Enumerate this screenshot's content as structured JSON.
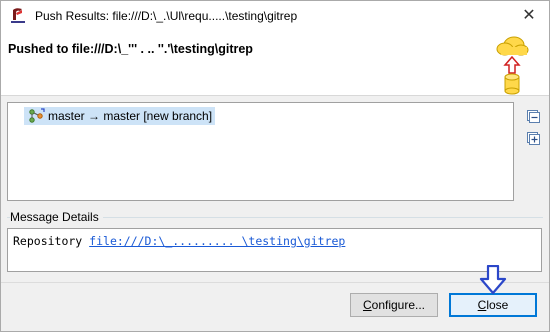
{
  "window": {
    "title": "Push Results: file:///D:\\_.\\Ul\\requ.....\\testing\\gitrep",
    "close_glyph": "✕"
  },
  "header": {
    "title": "Pushed to file:///D:\\_'''  .    ..  ''.'\\testing\\gitrep",
    "image_icon": "cloud-push-database-icon"
  },
  "results": {
    "rows": [
      {
        "icon": "branch-push-icon",
        "label": "master → master [new branch]"
      }
    ],
    "collapse_icon": "collapse-all-icon",
    "expand_icon": "expand-all-icon"
  },
  "message_details": {
    "label": "Message Details",
    "prefix": "Repository ",
    "link": "file:///D:\\_.........  \\testing\\gitrep"
  },
  "buttons": {
    "configure": {
      "label": "Configure...",
      "mnemonic": "C",
      "rest": "onfigure..."
    },
    "close": {
      "label": "Close",
      "mnemonic": "C",
      "rest": "lose"
    }
  },
  "colors": {
    "selection": "#cde3f7",
    "link": "#1a5ad6",
    "default_button_border": "#0078d7",
    "arrow": "#2b47c9"
  }
}
